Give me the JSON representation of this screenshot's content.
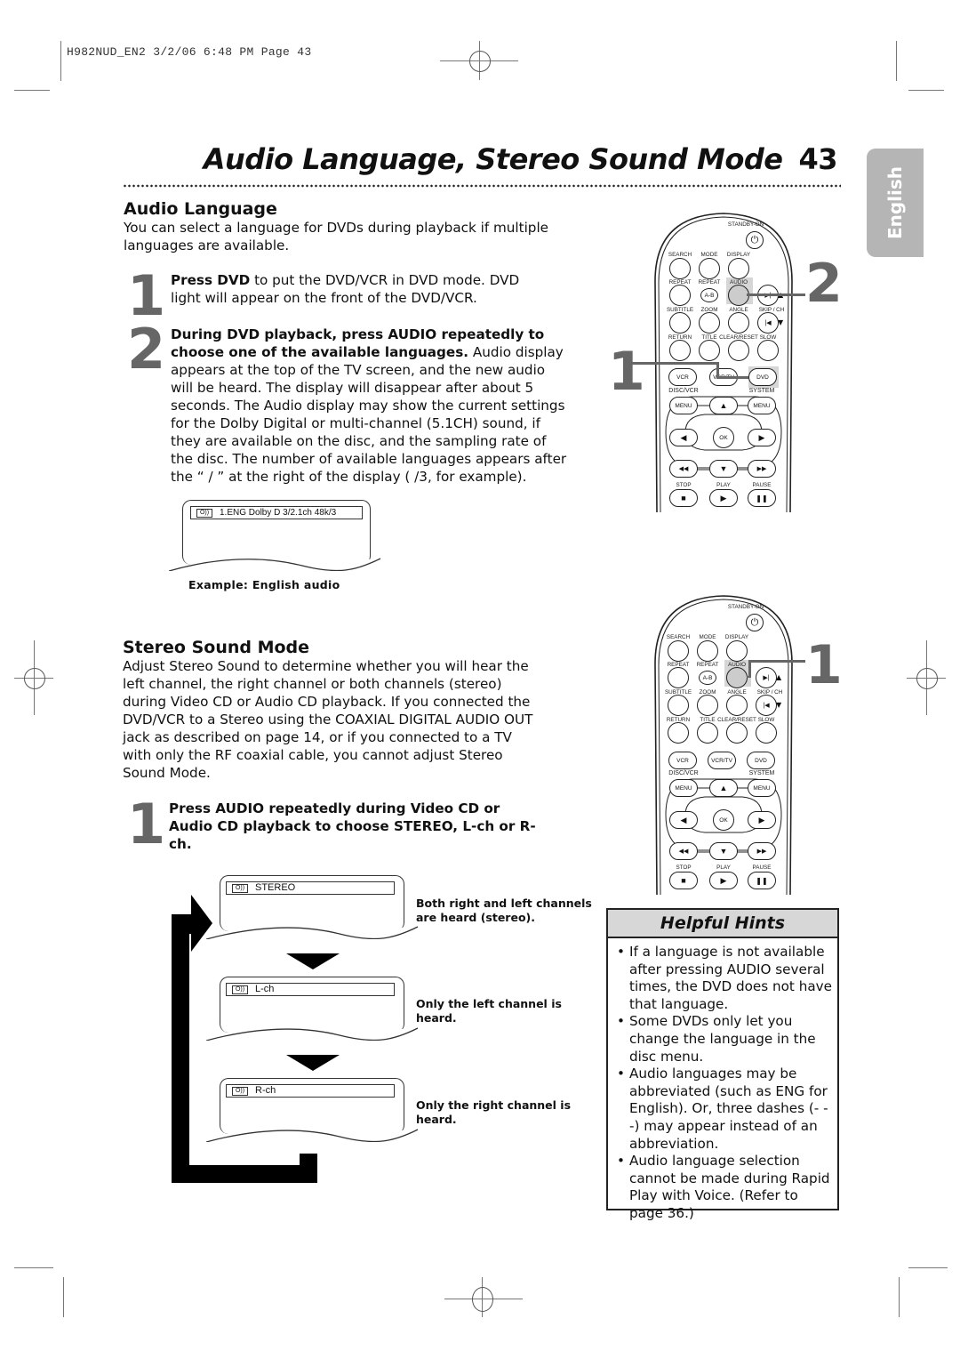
{
  "slug": "H982NUD_EN2  3/2/06  6:48 PM  Page 43",
  "page": {
    "title": "Audio Language, Stereo Sound Mode",
    "number": "43",
    "side_tab": "English"
  },
  "audio_language": {
    "heading": "Audio Language",
    "intro": "You can select a language for DVDs during playback if multiple languages are available.",
    "steps": [
      {
        "number": "1",
        "bold": "Press DVD",
        "text": " to put the DVD/VCR in DVD mode. DVD light will appear on the front of the DVD/VCR."
      },
      {
        "number": "2",
        "bold": "During DVD playback, press AUDIO repeatedly to choose one of the available languages.",
        "text": " Audio display appears at the top of the TV screen, and the new audio will be heard. The display will disappear after about 5 seconds. The Audio display may show the current settings for the Dolby Digital or multi-channel (5.1CH) sound, if they are available on the disc, and the sampling rate of the disc. The number of available languages appears after the “ / ” at the right of the display ( /3, for example)."
      }
    ],
    "example_osd": "1.ENG Dolby D 3/2.1ch 48k/3",
    "example_caption": "Example: English audio"
  },
  "stereo_mode": {
    "heading": "Stereo Sound Mode",
    "intro": "Adjust Stereo Sound to determine whether you will hear the left channel, the right channel or both channels (stereo) during Video CD or Audio CD playback. If you connected the DVD/VCR to a Stereo using the COAXIAL DIGITAL AUDIO OUT jack as described on page 14, or if you connected to a TV with only the RF coaxial cable, you cannot adjust Stereo Sound Mode.",
    "step": {
      "number": "1",
      "bold": "Press AUDIO repeatedly during Video CD or Audio CD playback to choose STEREO, L-ch or R-ch."
    },
    "modes": [
      {
        "osd": "STEREO",
        "caption": "Both right and left channels are heard (stereo)."
      },
      {
        "osd": "L-ch",
        "caption": "Only the left channel is heard."
      },
      {
        "osd": "R-ch",
        "caption": "Only the right channel is heard."
      }
    ]
  },
  "remote": {
    "standby": "STANDBY-ON",
    "row1": [
      "SEARCH",
      "MODE",
      "DISPLAY"
    ],
    "row2": [
      "REPEAT",
      "REPEAT",
      "AUDIO"
    ],
    "ab": "A-B",
    "row3": [
      "SUBTITLE",
      "ZOOM",
      "ANGLE",
      "SKIP / CH"
    ],
    "row4": [
      "RETURN",
      "TITLE",
      "CLEAR/RESET",
      "SLOW"
    ],
    "source": [
      "VCR",
      "VCR/TV",
      "DVD"
    ],
    "menu_labels": [
      "DISC/VCR",
      "SYSTEM"
    ],
    "menu": "MENU",
    "ok": "OK",
    "transport": [
      "STOP",
      "PLAY",
      "PAUSE"
    ],
    "callouts_top": [
      "1",
      "2"
    ],
    "callout_bottom": "1"
  },
  "helpful_hints": {
    "title": "Helpful Hints",
    "items": [
      "If a language is not available after pressing AUDIO several times, the DVD does not have that language.",
      "Some DVDs only let you change the language in the disc menu.",
      "Audio languages may be abbreviated (such as ENG for English). Or, three dashes (- - -) may appear instead of an abbreviation.",
      "Audio language selection cannot be made during Rapid Play with Voice. (Refer to page 36.)"
    ]
  }
}
